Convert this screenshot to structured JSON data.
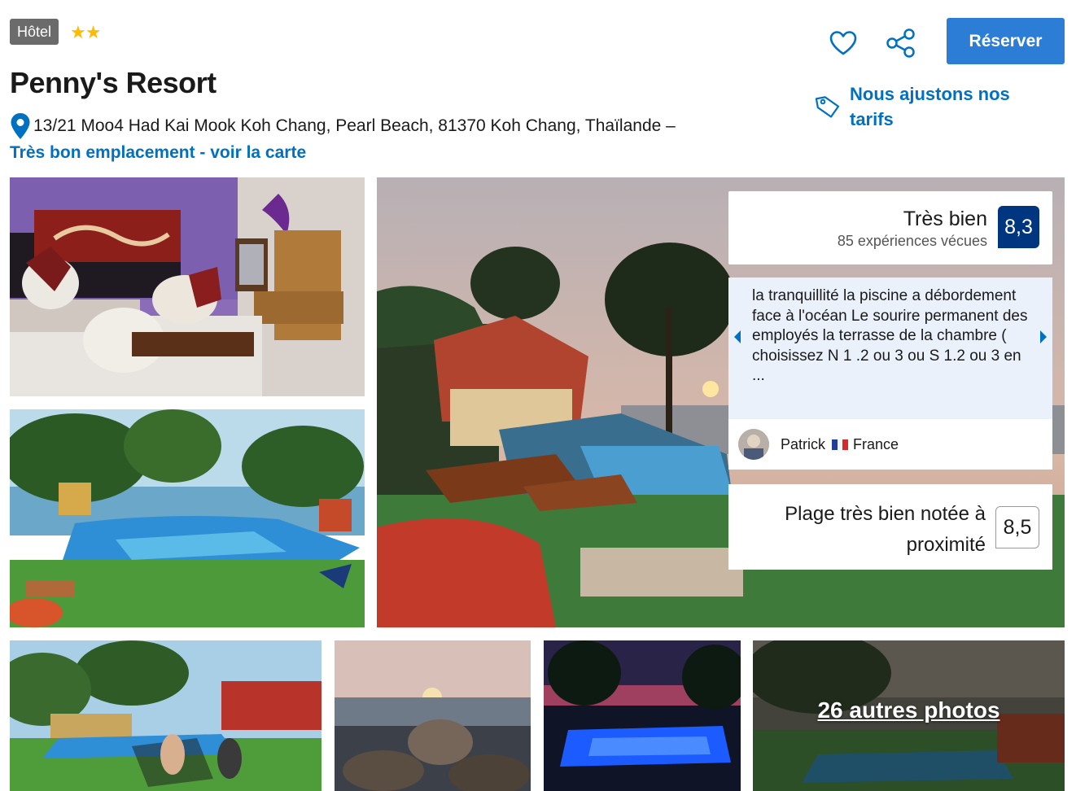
{
  "header": {
    "type_badge": "Hôtel",
    "stars": "★★",
    "hotel_name": "Penny's Resort",
    "address": "13/21 Moo4 Had Kai Mook Koh Chang, Pearl Beach, 81370 Koh Chang, Thaïlande –",
    "map_link": "Très bon emplacement - voir la carte",
    "reserve_label": "Réserver",
    "price_match": "Nous ajustons nos tarifs"
  },
  "rating": {
    "label": "Très bien",
    "count": "85 expériences vécues",
    "score": "8,3"
  },
  "review": {
    "text": "la tranquillité la piscine a débordement face à l'océan Le sourire permanent des employés la terrasse de la chambre ( choisissez N 1 .2 ou 3 ou S 1.2 ou 3 en ...",
    "author": "Patrick",
    "country": "France"
  },
  "beach": {
    "label": "Plage très bien notée à proximité",
    "score": "8,5"
  },
  "gallery": {
    "more_photos": "26 autres photos"
  },
  "icons": {
    "favorite": "heart-icon",
    "share": "share-icon",
    "location": "map-pin-icon",
    "price": "price-tag-icon"
  },
  "colors": {
    "brand_blue": "#0071c2",
    "button_blue": "#2c7dd6",
    "score_navy": "#003580",
    "stars": "#febb02",
    "review_bg": "#eaf1fb"
  }
}
